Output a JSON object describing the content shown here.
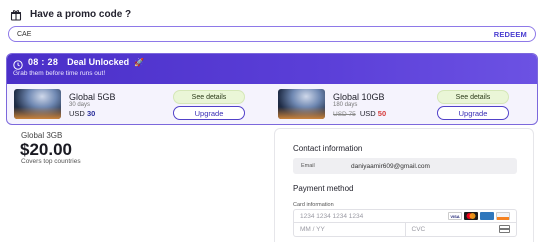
{
  "promo": {
    "title": "Have a promo code ?",
    "input_value": "CAE",
    "redeem_label": "REDEEM"
  },
  "deal": {
    "timer": "08 : 28",
    "label": "Deal Unlocked",
    "subtitle": "Grab them before time runs out!",
    "offers": [
      {
        "name": "Global 5GB",
        "days": "30 days",
        "currency": "USD",
        "old_price": "",
        "price": "30",
        "see_details": "See details",
        "upgrade": "Upgrade"
      },
      {
        "name": "Global 10GB",
        "days": "180 days",
        "currency": "USD",
        "old_price": "USD 75",
        "price": "50",
        "see_details": "See details",
        "upgrade": "Upgrade"
      }
    ]
  },
  "plan": {
    "name": "Global 3GB",
    "price": "$20.00",
    "coverage": "Covers top countries"
  },
  "checkout": {
    "contact_title": "Contact information",
    "email_label": "Email",
    "email_value": "daniyaamir609@gmail.com",
    "payment_title": "Payment method",
    "card_info_label": "Card information",
    "card_number_placeholder": "1234 1234 1234 1234",
    "expiry_placeholder": "MM / YY",
    "cvc_placeholder": "CVC",
    "brands": [
      "VISA",
      "MC",
      "AMEX",
      "DISC"
    ]
  },
  "colors": {
    "accent": "#4b3fd1",
    "deal_bar": "#5b3fd8",
    "see_details_bg": "#eaf6d7",
    "discount_price": "#d63b3b"
  }
}
